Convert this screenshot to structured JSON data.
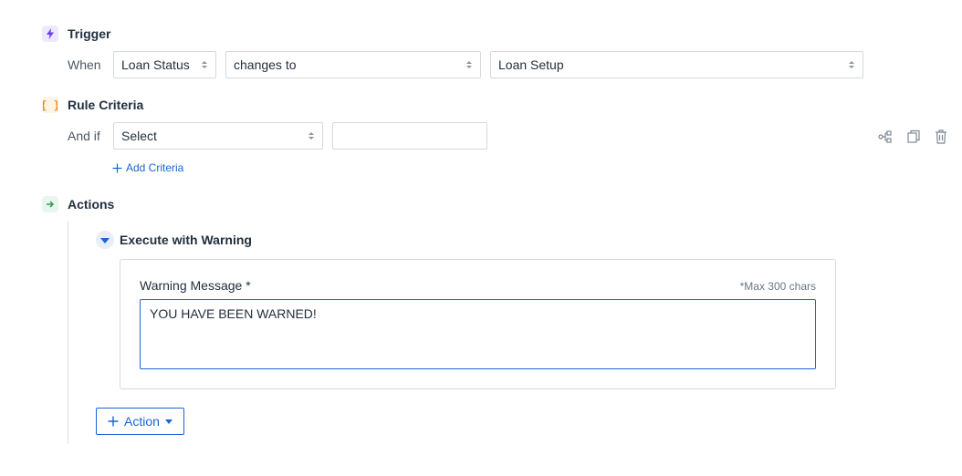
{
  "trigger": {
    "title": "Trigger",
    "icon": "lightning-icon",
    "icon_color": "#6b3ff0",
    "row_label": "When",
    "field_select": "Loan Status",
    "operator_select": "changes to",
    "value_select": "Loan Setup"
  },
  "criteria": {
    "title": "Rule Criteria",
    "icon": "braces-icon",
    "icon_color": "#f08a1c",
    "row_label": "And if",
    "field_select": "Select",
    "value_input": "",
    "add_link": "Add Criteria",
    "tools": [
      "hierarchy-icon",
      "copy-icon",
      "trash-icon"
    ]
  },
  "actions": {
    "title": "Actions",
    "icon": "arrow-right-icon",
    "icon_color": "#2e9b5c",
    "action_item": {
      "title": "Execute with Warning",
      "field_label": "Warning Message *",
      "max_hint": "*Max 300 chars",
      "message": "YOU HAVE BEEN WARNED!"
    },
    "add_button": "Action"
  },
  "colors": {
    "accent": "#1a64d6",
    "border": "#d4d9de",
    "text": "#22303e"
  }
}
